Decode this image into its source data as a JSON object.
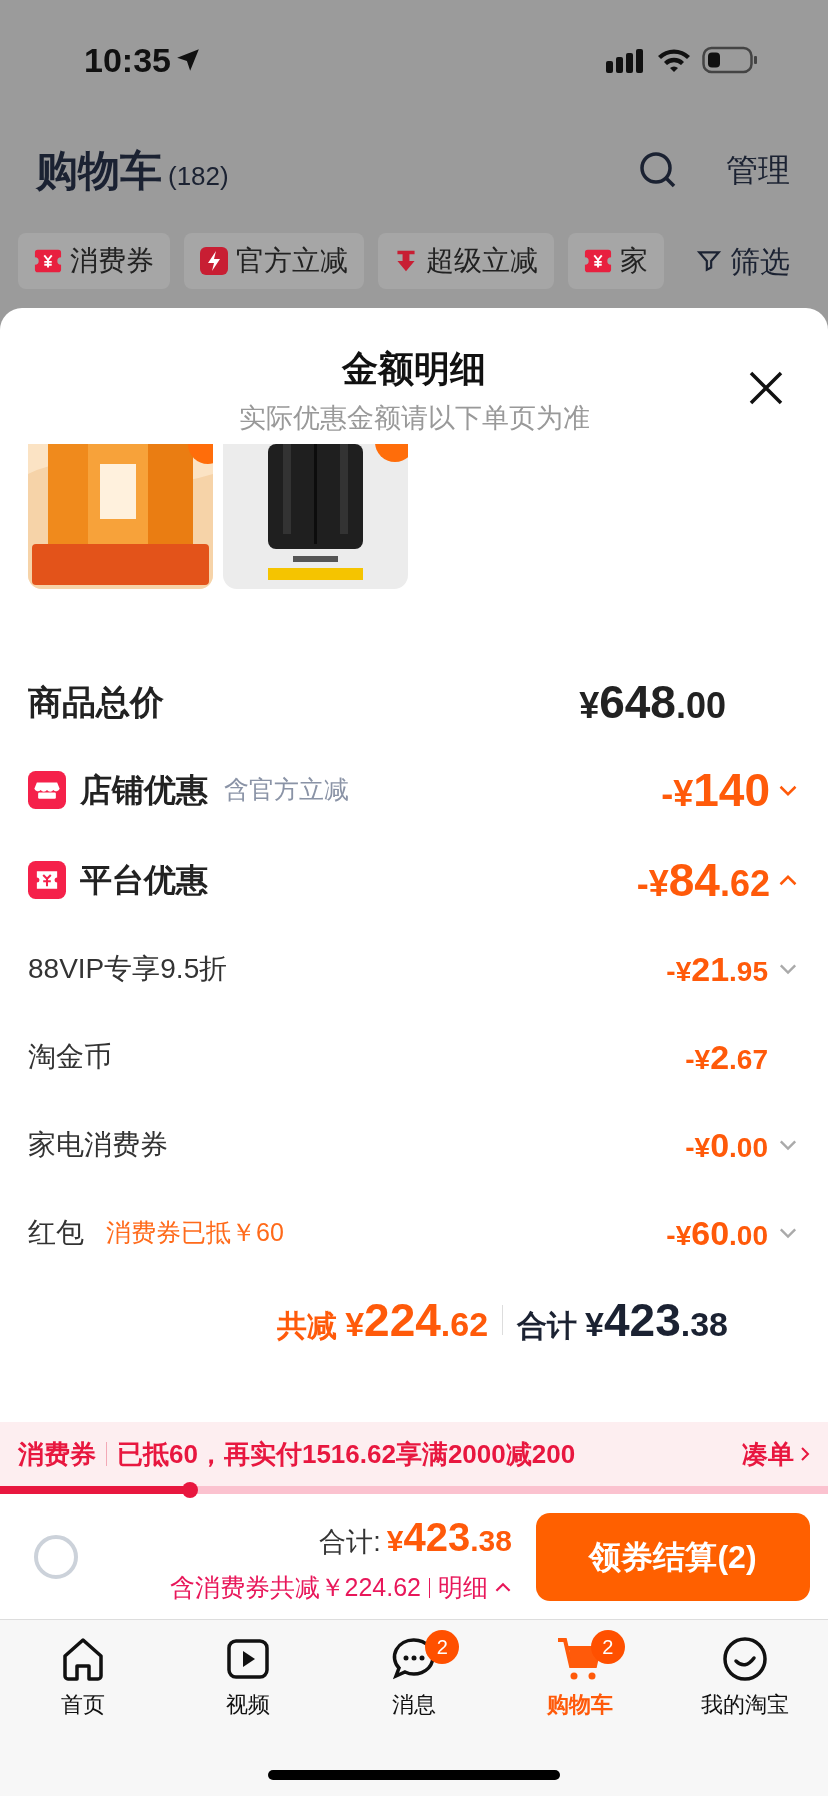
{
  "status_bar": {
    "time": "10:35"
  },
  "header": {
    "title": "购物车",
    "count": "(182)",
    "manage": "管理"
  },
  "filter_chips": [
    {
      "label": "消费券"
    },
    {
      "label": "官方立减"
    },
    {
      "label": "超级立减"
    },
    {
      "label": "家"
    }
  ],
  "filter_button": "筛选",
  "sheet": {
    "title": "金额明细",
    "subtitle": "实际优惠金额请以下单页为准",
    "rows": [
      {
        "kind": "total",
        "label": "商品总价",
        "amount": "¥648.00"
      },
      {
        "kind": "group",
        "label": "店铺优惠",
        "note": "含官方立减",
        "amount": "-¥140",
        "expanded": false
      },
      {
        "kind": "group",
        "label": "平台优惠",
        "amount": "-¥84.62",
        "expanded": true
      },
      {
        "kind": "detail",
        "label": "88VIP专享9.5折",
        "amount": "-¥21.95",
        "expandable": true
      },
      {
        "kind": "detail",
        "label": "淘金币",
        "amount": "-¥2.67",
        "expandable": false
      },
      {
        "kind": "detail",
        "label": "家电消费券",
        "amount": "-¥0.00",
        "expandable": true
      },
      {
        "kind": "detail",
        "label": "红包",
        "note": "消费券已抵￥60",
        "amount": "-¥60.00",
        "expandable": true
      }
    ],
    "summary": {
      "saved_label": "共减",
      "saved": "¥224.62",
      "total_label": "合计",
      "total": "¥423.38"
    }
  },
  "coupon_bar": {
    "tag": "消费券",
    "message": "已抵60，再实付1516.62享满2000减200",
    "link": "凑单",
    "level": 0.23
  },
  "checkout": {
    "checked": false,
    "total_label": "合计:",
    "total": "¥423.38",
    "note": "含消费券共减￥224.62",
    "detail_link": "明细",
    "button": "领券结算(2)"
  },
  "tabs": [
    {
      "label": "首页",
      "selected": false
    },
    {
      "label": "视频",
      "selected": false
    },
    {
      "label": "消息",
      "selected": false,
      "badge": "2"
    },
    {
      "label": "购物车",
      "selected": true,
      "badge": "2"
    },
    {
      "label": "我的淘宝",
      "selected": false
    }
  ]
}
